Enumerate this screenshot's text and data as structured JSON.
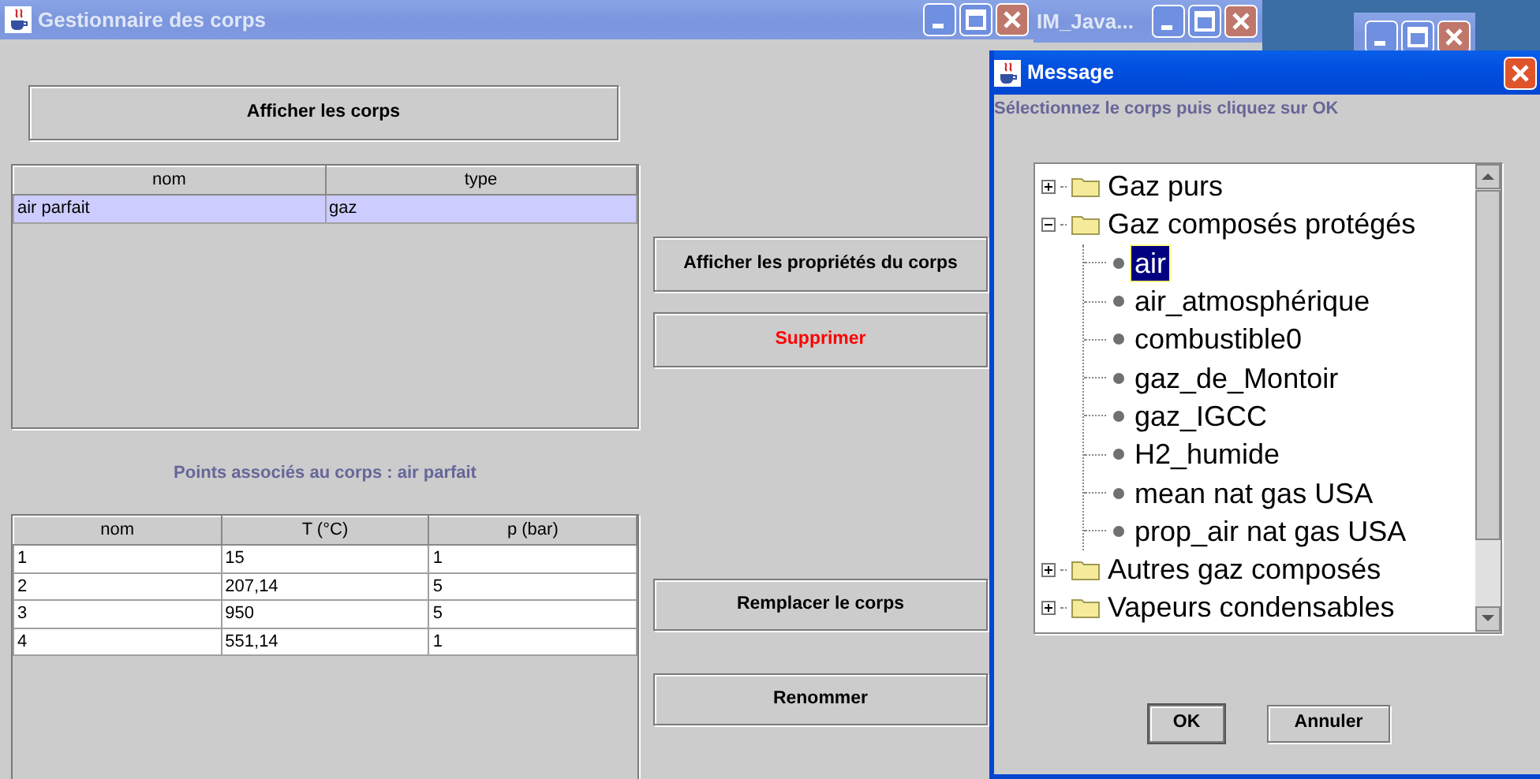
{
  "main_window": {
    "title": "Gestionnaire des corps",
    "show_button": "Afficher les corps",
    "bodies_table": {
      "columns": [
        "nom",
        "type"
      ],
      "rows": [
        {
          "cells": [
            "air parfait",
            "gaz"
          ],
          "selected": true
        }
      ]
    },
    "points_label": "Points associés au corps : air parfait",
    "points_table": {
      "columns": [
        "nom",
        "T (°C)",
        "p (bar)"
      ],
      "rows": [
        {
          "cells": [
            "1",
            "15",
            "1"
          ],
          "selected": false
        },
        {
          "cells": [
            "2",
            "207,14",
            "5"
          ],
          "selected": false
        },
        {
          "cells": [
            "3",
            "950",
            "5"
          ],
          "selected": false
        },
        {
          "cells": [
            "4",
            "551,14",
            "1"
          ],
          "selected": false
        }
      ]
    },
    "actions": [
      {
        "label": "Afficher les propriétés du corps",
        "kind": "normal"
      },
      {
        "label": "Supprimer",
        "kind": "danger"
      },
      {
        "label": "Remplacer le corps",
        "kind": "normal"
      },
      {
        "label": "Renommer",
        "kind": "normal"
      }
    ]
  },
  "second_window": {
    "title": "IM_Java..."
  },
  "dialog": {
    "title": "Message",
    "prompt": "Sélectionnez le corps puis cliquez sur OK",
    "tree": [
      {
        "label": "Gaz purs",
        "expanded": false,
        "selected": false
      },
      {
        "label": "Gaz composés protégés",
        "expanded": true,
        "selected": false,
        "children": [
          {
            "label": "air",
            "selected": true
          },
          {
            "label": "air_atmosphérique",
            "selected": false
          },
          {
            "label": "combustible0",
            "selected": false
          },
          {
            "label": "gaz_de_Montoir",
            "selected": false
          },
          {
            "label": "gaz_IGCC",
            "selected": false
          },
          {
            "label": "H2_humide",
            "selected": false
          },
          {
            "label": "mean nat gas USA",
            "selected": false
          },
          {
            "label": "prop_air nat gas USA",
            "selected": false
          }
        ]
      },
      {
        "label": "Autres gaz composés",
        "expanded": false,
        "selected": false
      },
      {
        "label": "Vapeurs condensables",
        "expanded": false,
        "selected": false
      }
    ],
    "buttons": [
      "OK",
      "Annuler"
    ]
  }
}
